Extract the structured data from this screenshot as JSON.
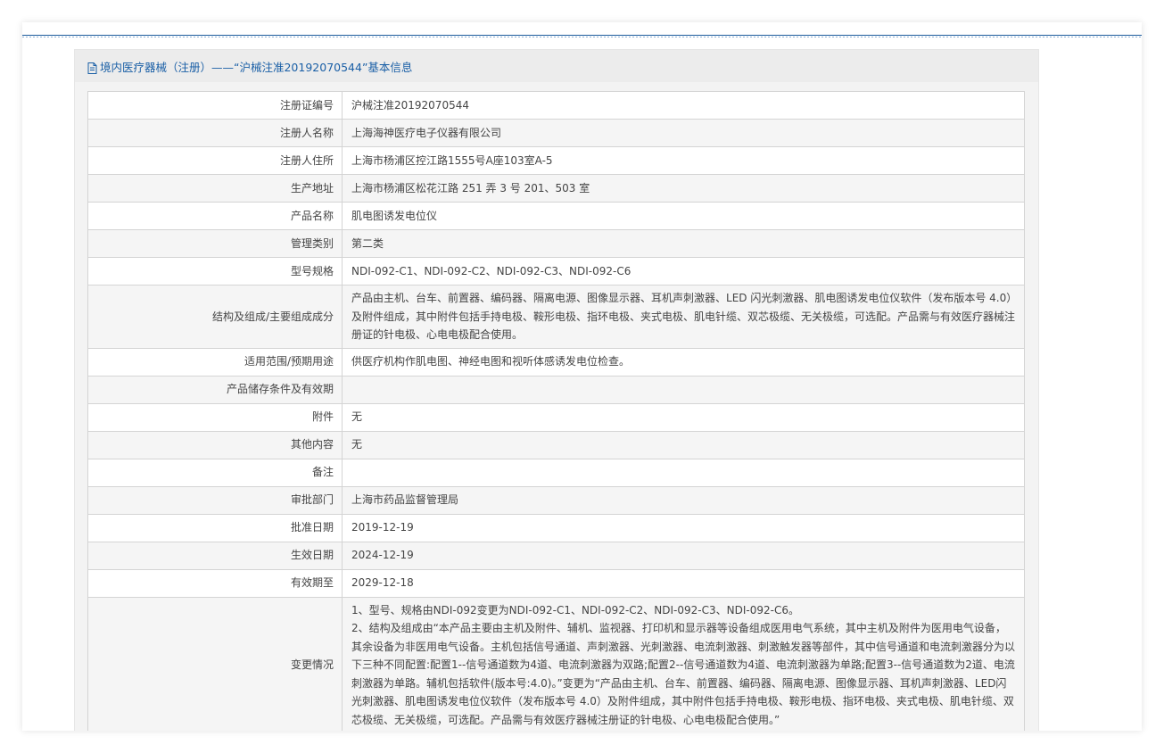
{
  "panel": {
    "title": "境内医疗器械（注册）——“沪械注准20192070544”基本信息",
    "title_color": "#1a5fa6"
  },
  "rows": [
    {
      "label": "注册证编号",
      "value": "沪械注准20192070544"
    },
    {
      "label": "注册人名称",
      "value": "上海海神医疗电子仪器有限公司"
    },
    {
      "label": "注册人住所",
      "value": "上海市杨浦区控江路1555号A座103室A-5"
    },
    {
      "label": "生产地址",
      "value": "上海市杨浦区松花江路 251 弄 3 号 201、503 室"
    },
    {
      "label": "产品名称",
      "value": "肌电图诱发电位仪"
    },
    {
      "label": "管理类别",
      "value": "第二类"
    },
    {
      "label": "型号规格",
      "value": "NDI-092-C1、NDI-092-C2、NDI-092-C3、NDI-092-C6"
    },
    {
      "label": "结构及组成/主要组成成分",
      "value": "产品由主机、台车、前置器、编码器、隔离电源、图像显示器、耳机声刺激器、LED 闪光刺激器、肌电图诱发电位仪软件（发布版本号 4.0）及附件组成，其中附件包括手持电极、鞍形电极、指环电极、夹式电极、肌电针缆、双芯极缆、无关极缆，可选配。产品需与有效医疗器械注册证的针电极、心电电极配合使用。"
    },
    {
      "label": "适用范围/预期用途",
      "value": "供医疗机构作肌电图、神经电图和视听体感诱发电位检查。"
    },
    {
      "label": "产品储存条件及有效期",
      "value": ""
    },
    {
      "label": "附件",
      "value": "无"
    },
    {
      "label": "其他内容",
      "value": "无"
    },
    {
      "label": "备注",
      "value": ""
    },
    {
      "label": "审批部门",
      "value": "上海市药品监督管理局"
    },
    {
      "label": "批准日期",
      "value": "2019-12-19"
    },
    {
      "label": "生效日期",
      "value": "2024-12-19"
    },
    {
      "label": "有效期至",
      "value": "2029-12-18"
    }
  ],
  "change": {
    "label": "变更情况",
    "line1": "1、型号、规格由NDI-092变更为NDI-092-C1、NDI-092-C2、NDI-092-C3、NDI-092-C6。",
    "line2": "2、结构及组成由“本产品主要由主机及附件、辅机、监视器、打印机和显示器等设备组成医用电气系统，其中主机及附件为医用电气设备，其余设备为非医用电气设备。主机包括信号通道、声刺激器、光刺激器、电流刺激器、刺激触发器等部件，其中信号通道和电流刺激器分为以下三种不同配置:配置1--信号通道数为4道、电流刺激器为双路;配置2--信号通道数为4道、电流刺激器为单路;配置3--信号通道数为2道、电流刺激器为单路。辅机包括软件(版本号:4.0)。”变更为“产品由主机、台车、前置器、编码器、隔离电源、图像显示器、耳机声刺激器、LED闪光刺激器、肌电图诱发电位仪软件（发布版本号 4.0）及附件组成，其中附件包括手持电极、鞍形电极、指环电极、夹式电极、肌电针缆、双芯极缆、无关极缆，可选配。产品需与有效医疗器械注册证的针电极、心电电极配合使用。”"
  }
}
